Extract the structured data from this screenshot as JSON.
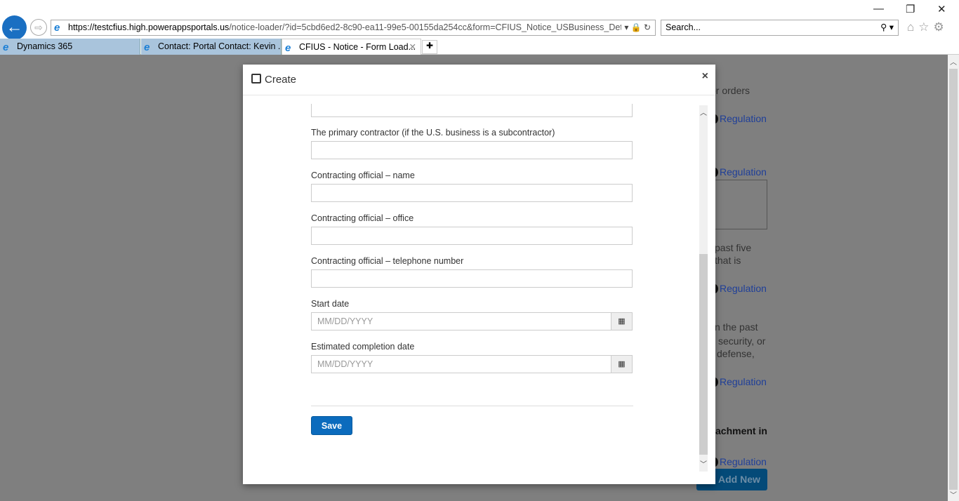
{
  "browser": {
    "url_prefix": "https://testcfius.high.",
    "url_domain": "powerappsportals.us",
    "url_rest": "/notice-loader/?id=5cbd6ed2-8c90-ea11-99e5-00155da254cc&form=CFIUS_Notice_USBusiness_Details",
    "search_placeholder": "Search...",
    "tabs": [
      {
        "label": "Dynamics 365"
      },
      {
        "label": "Contact: Portal Contact: Kevin ..."
      },
      {
        "label": "CFIUS - Notice - Form Load..."
      }
    ]
  },
  "background": {
    "texts": [
      "or orders",
      "past five",
      "that is",
      "n the past",
      "security, or",
      "defense,",
      "achment in"
    ],
    "regulation_link": "Regulation",
    "add_new": "Add New"
  },
  "modal": {
    "title": "Create",
    "close": "×",
    "fields": [
      {
        "label": ""
      },
      {
        "label": "The primary contractor (if the U.S. business is a subcontractor)"
      },
      {
        "label": "Contracting official – name"
      },
      {
        "label": "Contracting official – office"
      },
      {
        "label": "Contracting official – telephone number"
      }
    ],
    "date_fields": [
      {
        "label": "Start date",
        "placeholder": "MM/DD/YYYY"
      },
      {
        "label": "Estimated completion date",
        "placeholder": "MM/DD/YYYY"
      }
    ],
    "save": "Save"
  }
}
